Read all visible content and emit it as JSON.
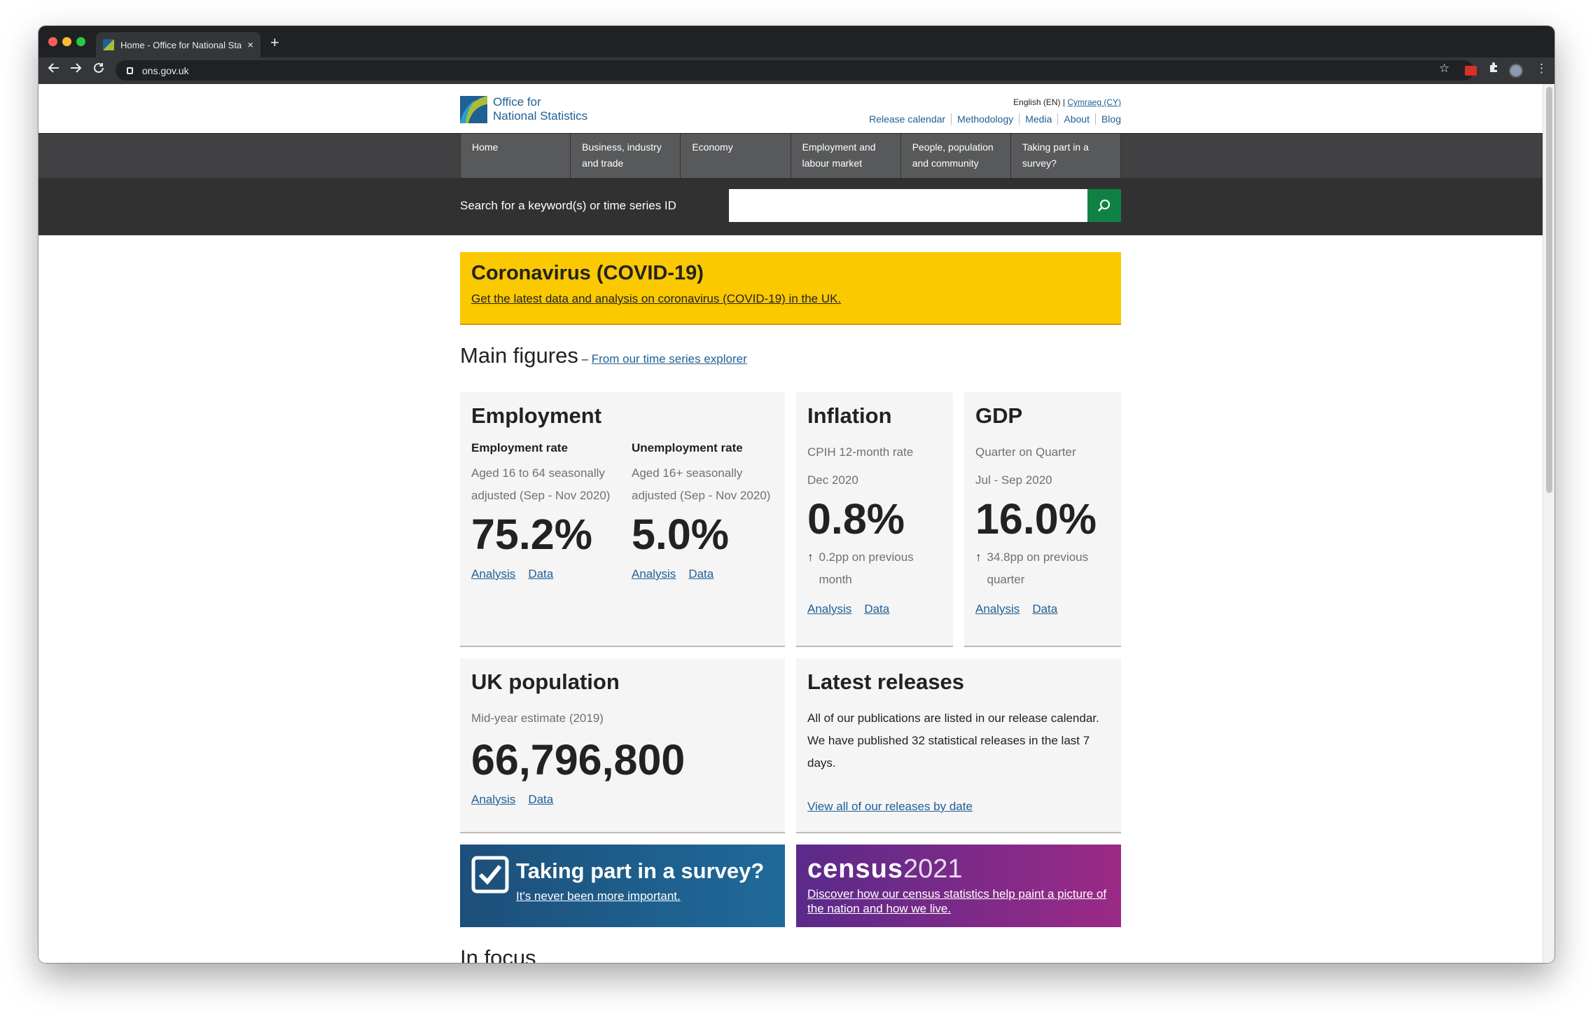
{
  "browser": {
    "tab_title": "Home - Office for National Statistics",
    "tab_close": "×",
    "new_tab": "+",
    "url": "ons.gov.uk",
    "back_icon": "arrow-left-icon",
    "forward_icon": "arrow-right-icon",
    "reload_icon": "reload-icon"
  },
  "header": {
    "logo_line1": "Office for",
    "logo_line2": "National Statistics",
    "lang_current": "English (EN)",
    "lang_sep": " | ",
    "lang_other": "Cymraeg (CY)",
    "util_links": [
      "Release calendar",
      "Methodology",
      "Media",
      "About",
      "Blog"
    ]
  },
  "nav": {
    "items": [
      "Home",
      "Business, industry and trade",
      "Economy",
      "Employment and labour market",
      "People, population and community",
      "Taking part in a survey?"
    ]
  },
  "search": {
    "label": "Search for a keyword(s) or time series ID",
    "placeholder": ""
  },
  "banner": {
    "title": "Coronavirus (COVID-19)",
    "link": "Get the latest data and analysis on coronavirus (COVID-19) in the UK."
  },
  "main_figures": {
    "title": "Main figures",
    "sep": " – ",
    "link": "From our time series explorer"
  },
  "employment": {
    "title": "Employment",
    "rate_label": "Employment rate",
    "rate_desc": "Aged 16 to 64 seasonally adjusted (Sep - Nov 2020)",
    "rate_value": "75.2%",
    "unemp_label": "Unemployment rate",
    "unemp_desc": "Aged 16+ seasonally adjusted (Sep - Nov 2020)",
    "unemp_value": "5.0%",
    "analysis": "Analysis",
    "data": "Data"
  },
  "inflation": {
    "title": "Inflation",
    "label": "CPIH 12-month rate",
    "period": "Dec 2020",
    "value": "0.8%",
    "change_arrow": "↑",
    "change": "0.2pp on previous month",
    "analysis": "Analysis",
    "data": "Data"
  },
  "gdp": {
    "title": "GDP",
    "label": "Quarter on Quarter",
    "period": "Jul - Sep 2020",
    "value": "16.0%",
    "change_arrow": "↑",
    "change": "34.8pp on previous quarter",
    "analysis": "Analysis",
    "data": "Data"
  },
  "population": {
    "title": "UK population",
    "label": "Mid-year estimate (2019)",
    "value": "66,796,800",
    "analysis": "Analysis",
    "data": "Data"
  },
  "releases": {
    "title": "Latest releases",
    "text": "All of our publications are listed in our release calendar. We have published 32 statistical releases in the last 7 days.",
    "link": "View all of our releases by date"
  },
  "survey_promo": {
    "title": "Taking part in a survey?",
    "link": "It's never been more important.",
    "bg": "#1f5f8f"
  },
  "census_promo": {
    "wordmark": "census",
    "year": "2021",
    "link": "Discover how our census statistics help paint a picture of the nation and how we live.",
    "bg": "#8a2d8a"
  },
  "in_focus": {
    "title": "In focus"
  },
  "colors": {
    "ons_blue": "#206095",
    "banner_yellow": "#fbc900",
    "search_green": "#0f8243"
  }
}
